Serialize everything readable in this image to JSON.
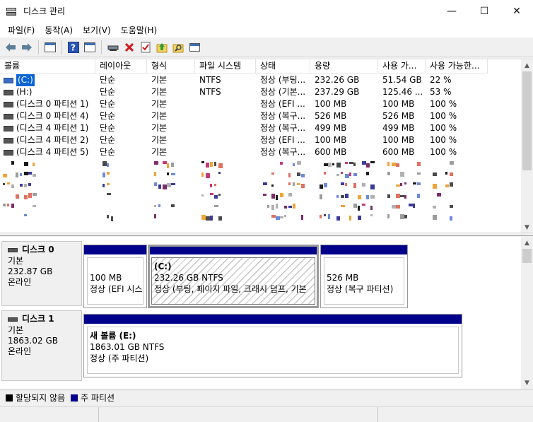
{
  "window": {
    "title": "디스크 관리",
    "minimize": "—",
    "maximize": "☐",
    "close": "✕"
  },
  "menu": [
    "파일(F)",
    "동작(A)",
    "보기(V)",
    "도움말(H)"
  ],
  "toolbar": {
    "icons": [
      "back-arrow-icon",
      "forward-arrow-icon",
      "properties-icon",
      "help-icon",
      "console-view-icon",
      "connect-drive-icon",
      "delete-icon",
      "checklist-icon",
      "up-arrow-icon",
      "search-icon",
      "window-icon"
    ]
  },
  "columns": [
    "볼륨",
    "레이아웃",
    "형식",
    "파일 시스템",
    "상태",
    "용량",
    "사용 가...",
    "사용 가능한..."
  ],
  "volumes": [
    {
      "name": "(C:)",
      "layout": "단순",
      "type": "기본",
      "fs": "NTFS",
      "status": "정상 (부팅...",
      "capacity": "232.26 GB",
      "free": "51.54 GB",
      "pct": "22 %"
    },
    {
      "name": "(H:)",
      "layout": "단순",
      "type": "기본",
      "fs": "NTFS",
      "status": "정상 (기본...",
      "capacity": "237.29 GB",
      "free": "125.46 ...",
      "pct": "53 %"
    },
    {
      "name": "(디스크 0 파티션 1)",
      "layout": "단순",
      "type": "기본",
      "fs": "",
      "status": "정상 (EFI ...",
      "capacity": "100 MB",
      "free": "100 MB",
      "pct": "100 %"
    },
    {
      "name": "(디스크 0 파티션 4)",
      "layout": "단순",
      "type": "기본",
      "fs": "",
      "status": "정상 (복구...",
      "capacity": "526 MB",
      "free": "526 MB",
      "pct": "100 %"
    },
    {
      "name": "(디스크 4 파티션 1)",
      "layout": "단순",
      "type": "기본",
      "fs": "",
      "status": "정상 (복구...",
      "capacity": "499 MB",
      "free": "499 MB",
      "pct": "100 %"
    },
    {
      "name": "(디스크 4 파티션 2)",
      "layout": "단순",
      "type": "기본",
      "fs": "",
      "status": "정상 (EFI ...",
      "capacity": "100 MB",
      "free": "100 MB",
      "pct": "100 %"
    },
    {
      "name": "(디스크 4 파티션 5)",
      "layout": "단순",
      "type": "기본",
      "fs": "",
      "status": "정상 (복구...",
      "capacity": "600 MB",
      "free": "600 MB",
      "pct": "100 %"
    }
  ],
  "disks": [
    {
      "name": "디스크 0",
      "type": "기본",
      "size": "232.87 GB",
      "state": "온라인",
      "partitions": [
        {
          "line1": "",
          "line2": "100 MB",
          "line3": "정상 (EFI 시스"
        },
        {
          "line1": "(C:)",
          "line2": "232.26 GB NTFS",
          "line3": "정상 (부팅, 페이지 파일, 크래시 덤프, 기본"
        },
        {
          "line1": "",
          "line2": "526 MB",
          "line3": "정상 (복구 파티션)"
        }
      ]
    },
    {
      "name": "디스크 1",
      "type": "기본",
      "size": "1863.02 GB",
      "state": "온라인",
      "partitions": [
        {
          "line1": "새 볼륨  (E:)",
          "line2": "1863.01 GB NTFS",
          "line3": "정상 (주 파티션)"
        }
      ]
    }
  ],
  "legend": [
    {
      "label": "할당되지 않음",
      "color": "#000000"
    },
    {
      "label": "주 파티션",
      "color": "#00008b"
    }
  ],
  "colors": {
    "primary_partition": "#00008b",
    "selection": "#0a64d6"
  }
}
